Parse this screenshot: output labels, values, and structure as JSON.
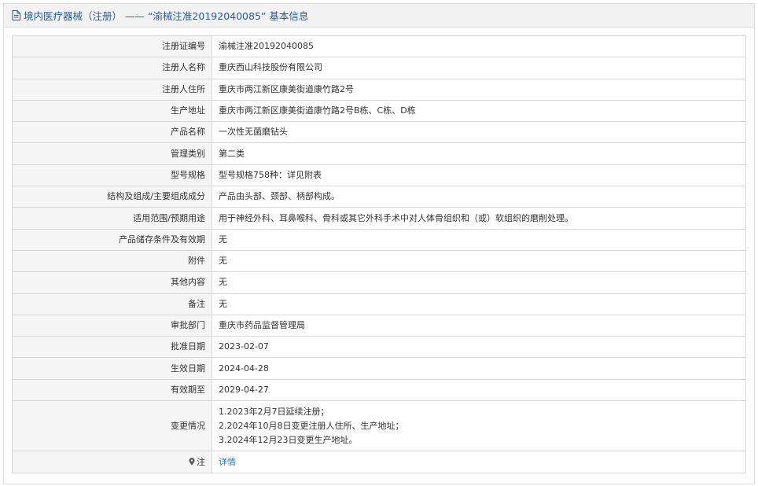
{
  "header": {
    "icon": "document-icon",
    "title": "境内医疗器械（注册） —— “渝械注准20192040085” 基本信息"
  },
  "rows": [
    {
      "label": "注册证编号",
      "value": "渝械注准20192040085"
    },
    {
      "label": "注册人名称",
      "value": "重庆西山科技股份有限公司"
    },
    {
      "label": "注册人住所",
      "value": "重庆市两江新区康美街道康竹路2号"
    },
    {
      "label": "生产地址",
      "value": "重庆市两江新区康美街道康竹路2号B栋、C栋、D栋"
    },
    {
      "label": "产品名称",
      "value": "一次性无菌磨钻头"
    },
    {
      "label": "管理类别",
      "value": "第二类"
    },
    {
      "label": "型号规格",
      "value": "型号规格758种：详见附表"
    },
    {
      "label": "结构及组成/主要组成成分",
      "value": "产品由头部、颈部、柄部构成。"
    },
    {
      "label": "适用范围/预期用途",
      "value": "用于神经外科、耳鼻喉科、骨科或其它外科手术中对人体骨组织和（或）软组织的磨削处理。"
    },
    {
      "label": "产品储存条件及有效期",
      "value": "无"
    },
    {
      "label": "附件",
      "value": "无"
    },
    {
      "label": "其他内容",
      "value": "无"
    },
    {
      "label": "备注",
      "value": "无"
    },
    {
      "label": "审批部门",
      "value": "重庆市药品监督管理局"
    },
    {
      "label": "批准日期",
      "value": "2023-02-07"
    },
    {
      "label": "生效日期",
      "value": "2024-04-28"
    },
    {
      "label": "有效期至",
      "value": "2029-04-27"
    }
  ],
  "changes": {
    "label": "变更情况",
    "lines": [
      "1.2023年2月7日延续注册；",
      "2.2024年10月8日变更注册人住所、生产地址；",
      "3.2024年12月23日变更生产地址。"
    ]
  },
  "note": {
    "icon": "location-pin-icon",
    "label": "注",
    "link_text": "详情",
    "link_color": "#2a7bc0"
  }
}
